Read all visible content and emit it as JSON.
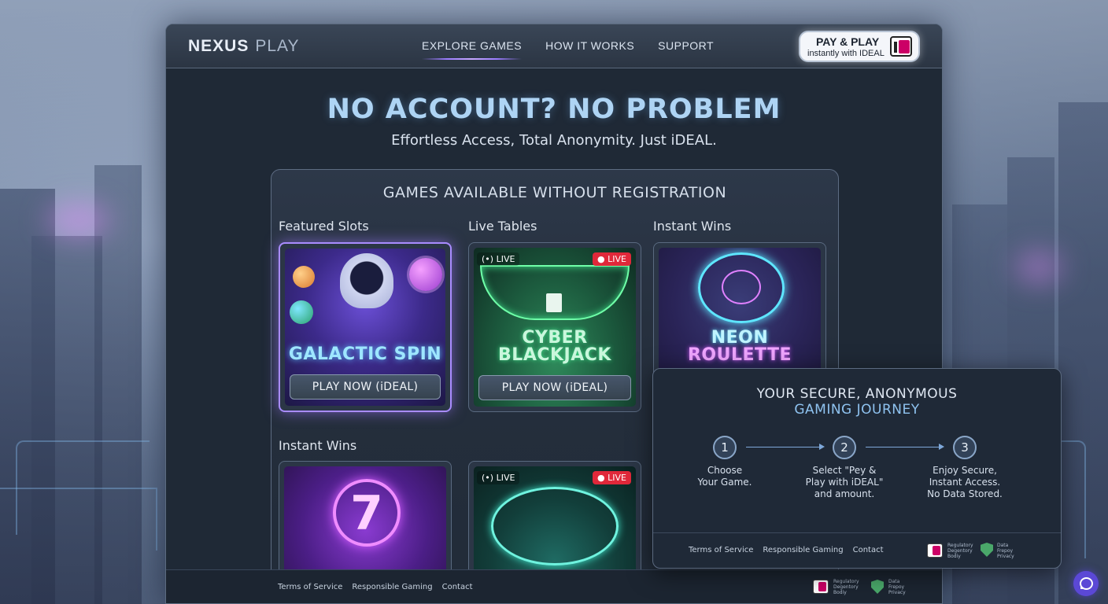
{
  "brand": {
    "name_part1": "NEXUS",
    "name_part2": "PLAY"
  },
  "nav": {
    "items": [
      {
        "label": "EXPLORE GAMES",
        "active": true
      },
      {
        "label": "HOW IT WORKS",
        "active": false
      },
      {
        "label": "SUPPORT",
        "active": false
      }
    ]
  },
  "pay_button": {
    "title": "PAY & PLAY",
    "subtitle": "instantly with IDEAL",
    "icon": "ideal-logo-icon"
  },
  "hero": {
    "title": "NO ACCOUNT? NO PROBLEM",
    "subtitle": "Effortless Access, Total Anonymity. Just iDEAL."
  },
  "games_section": {
    "title": "GAMES AVAILABLE WITHOUT REGISTRATION",
    "categories": [
      "Featured Slots",
      "Live Tables",
      "Instant Wins",
      "Instant Wins"
    ],
    "cards": [
      {
        "title": "GALACTIC SPIN",
        "play_label": "PLAY NOW (iDEAL)",
        "featured": true
      },
      {
        "title_line1": "CYBER",
        "title_line2": "BLACKJACK",
        "play_label": "PLAY NOW (iDEAL)",
        "live_label": "LIVE",
        "live_badge": "LIVE"
      },
      {
        "title_line1": "NEON",
        "title_line2": "ROULETTE"
      },
      {
        "title": ""
      },
      {
        "live_label": "LIVE",
        "live_badge": "LIVE"
      }
    ]
  },
  "journey": {
    "title_line1": "YOUR SECURE, ANONYMOUS",
    "title_line2": "GAMING JOURNEY",
    "steps": [
      {
        "num": "1",
        "text_line1": "Choose",
        "text_line2": "Your Game.",
        "text_line3": ""
      },
      {
        "num": "2",
        "text_line1": "Select \"Pey &",
        "text_line2": "Play with iDEAL\"",
        "text_line3": "and amount."
      },
      {
        "num": "3",
        "text_line1": "Enjoy Secure,",
        "text_line2": "Instant Access.",
        "text_line3": "No Data Stored."
      }
    ],
    "links": [
      "Terms of Service",
      "Responsible Gaming",
      "Contact"
    ],
    "badges": {
      "regulatory": [
        "Regulatory",
        "Degentory",
        "Bodiy"
      ],
      "privacy": [
        "Data",
        "Frepoy",
        "Privacy"
      ]
    }
  },
  "footer": {
    "links": [
      "Terms of Service",
      "Responsible Gaming",
      "Contact"
    ],
    "badges": {
      "regulatory": [
        "Regulatory",
        "Degentory",
        "Bodiy"
      ],
      "privacy": [
        "Data",
        "Frepoy",
        "Privacy"
      ]
    }
  },
  "colors": {
    "accent_purple": "#a98cff",
    "title_blue": "#aed4f4",
    "live_red": "#e0283a",
    "panel_bg": "#1f2936"
  }
}
